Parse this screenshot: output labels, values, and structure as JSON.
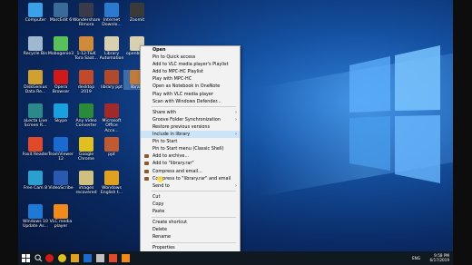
{
  "desktop": {
    "icons": [
      {
        "label": "Computer",
        "color": "#3aa0e8"
      },
      {
        "label": "Recycle Bin",
        "color": "#9fb8d0"
      },
      {
        "label": "DiskGenius Data Re...",
        "color": "#d0a030"
      },
      {
        "label": "aLecta Live Screen R...",
        "color": "#2a8a8a"
      },
      {
        "label": "Foxit Reader",
        "color": "#e04a2a"
      },
      {
        "label": "Free Cam 8",
        "color": "#2aa0d0"
      },
      {
        "label": "Windows 10 Update As...",
        "color": "#1e78d6"
      },
      {
        "label": "MarcEdit 6",
        "color": "#3a6a9a"
      },
      {
        "label": "Mobogenie3",
        "color": "#5ac05a"
      },
      {
        "label": "Opera Browser",
        "color": "#d01a1a"
      },
      {
        "label": "Skype",
        "color": "#1aa0e0"
      },
      {
        "label": "TeamViewer 12",
        "color": "#1a6ad0"
      },
      {
        "label": "VideoScribe",
        "color": "#2a5ab0"
      },
      {
        "label": "VLC media player",
        "color": "#f08a1a"
      },
      {
        "label": "Wondershare Filmora",
        "color": "#3a3a4a"
      },
      {
        "label": "1-12-T&K Tora Saat...",
        "color": "#d08a3a"
      },
      {
        "label": "desktop 2019",
        "color": "#c04a2a"
      },
      {
        "label": "Any Video Converter",
        "color": "#2a8a3a"
      },
      {
        "label": "Google Chrome",
        "color": "#e0c020"
      },
      {
        "label": "images recovered",
        "color": "#d0c080"
      },
      {
        "label": "Internet Downlo...",
        "color": "#2a7ad0"
      },
      {
        "label": "Library Automation",
        "color": "#d8d0b0"
      },
      {
        "label": "library ppt",
        "color": "#b04a2a"
      },
      {
        "label": "Microsoft Office Acce...",
        "color": "#a02a2a"
      },
      {
        "label": "ppt",
        "color": "#c05a30"
      },
      {
        "label": "Wondows English t...",
        "color": "#e0a020"
      },
      {
        "label": "Zoomit",
        "color": "#3a3a3a"
      },
      {
        "label": "openbiblio",
        "color": "#d8d0b0"
      },
      {
        "label": "library",
        "color": "#c07a3a"
      }
    ]
  },
  "context_menu": {
    "items": [
      {
        "label": "Open",
        "bold": true
      },
      {
        "label": "Pin to Quick access"
      },
      {
        "label": "Add to VLC media player's Playlist"
      },
      {
        "label": "Add to MPC-HC Playlist"
      },
      {
        "label": "Play with MPC-HC"
      },
      {
        "label": "Open as Notebook in OneNote"
      },
      {
        "label": "Play with VLC media player"
      },
      {
        "label": "Scan with Windows Defender..."
      },
      {
        "sep": true
      },
      {
        "label": "Share with",
        "arrow": true
      },
      {
        "label": "Groove Folder Synchronization",
        "arrow": true
      },
      {
        "label": "Restore previous versions"
      },
      {
        "label": "Include in library",
        "arrow": true,
        "highlight": true
      },
      {
        "label": "Pin to Start"
      },
      {
        "label": "Pin to Start menu (Classic Shell)"
      },
      {
        "label": "Add to archive...",
        "icon": true
      },
      {
        "label": "Add to \"library.rar\"",
        "icon": true
      },
      {
        "label": "Compress and email...",
        "icon": true
      },
      {
        "label": "Compress to \"library.rar\" and email",
        "icon": true
      },
      {
        "label": "Send to",
        "arrow": true
      },
      {
        "sep": true
      },
      {
        "label": "Cut"
      },
      {
        "label": "Copy"
      },
      {
        "label": "Paste"
      },
      {
        "sep": true
      },
      {
        "label": "Create shortcut"
      },
      {
        "label": "Delete"
      },
      {
        "label": "Rename"
      },
      {
        "sep": true
      },
      {
        "label": "Properties"
      }
    ]
  },
  "taskbar": {
    "clock_time": "9:58 PM",
    "clock_date": "6/17/2019",
    "lang": "ENG"
  }
}
